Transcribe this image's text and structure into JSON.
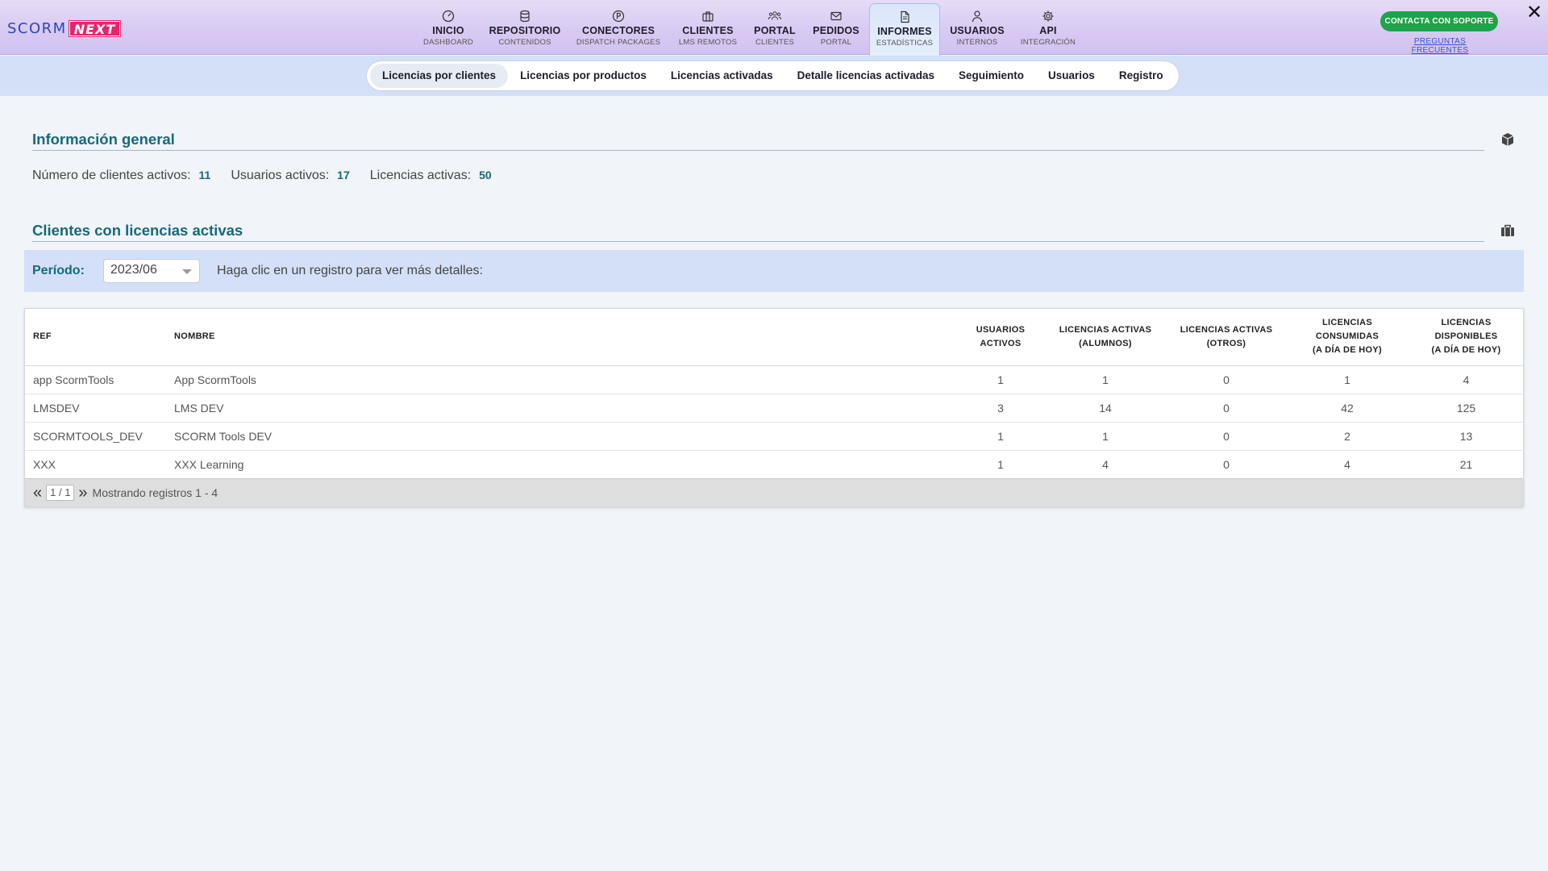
{
  "logo": {
    "part1": "SCORM",
    "part2": "NEXT"
  },
  "nav": [
    {
      "label": "INICIO",
      "sub": "DASHBOARD",
      "icon": "dashboard-gauge-icon"
    },
    {
      "label": "REPOSITORIO",
      "sub": "CONTENIDOS",
      "icon": "database-icon"
    },
    {
      "label": "CONECTORES",
      "sub": "DISPATCH PACKAGES",
      "icon": "connector-circle-icon"
    },
    {
      "label": "CLIENTES",
      "sub": "LMS REMOTOS",
      "icon": "briefcase-icon"
    },
    {
      "label": "PORTAL",
      "sub": "CLIENTES",
      "icon": "users-group-icon"
    },
    {
      "label": "PEDIDOS",
      "sub": "PORTAL",
      "icon": "envelope-icon"
    },
    {
      "label": "INFORMES",
      "sub": "ESTADÍSTICAS",
      "icon": "document-icon",
      "active": true
    },
    {
      "label": "USUARIOS",
      "sub": "INTERNOS",
      "icon": "user-icon"
    },
    {
      "label": "API",
      "sub": "INTEGRACIÓN",
      "icon": "gear-icon"
    }
  ],
  "support_button": "CONTACTA CON SOPORTE",
  "faq_link": "PREGUNTAS FRECUENTES",
  "close_symbol": "✕",
  "subnav": [
    {
      "label": "Licencias por clientes",
      "active": true
    },
    {
      "label": "Licencias por productos"
    },
    {
      "label": "Licencias activadas"
    },
    {
      "label": "Detalle licencias activadas"
    },
    {
      "label": "Seguimiento"
    },
    {
      "label": "Usuarios"
    },
    {
      "label": "Registro"
    }
  ],
  "general": {
    "title": "Información general",
    "icon": "cube-icon",
    "clients_label": "Número de clientes activos:",
    "clients_value": "11",
    "users_label": "Usuarios activos:",
    "users_value": "17",
    "licenses_label": "Licencias activas:",
    "licenses_value": "50"
  },
  "clients_section": {
    "title": "Clientes con licencias activas",
    "icon": "briefcase-icon",
    "period_label": "Período:",
    "period_value": "2023/06",
    "hint": "Haga clic en un registro para ver más detalles:"
  },
  "table": {
    "headers": {
      "ref": "REF",
      "nombre": "NOMBRE",
      "usuarios_1": "USUARIOS",
      "usuarios_2": "ACTIVOS",
      "lic_alumnos_1": "LICENCIAS ACTIVAS",
      "lic_alumnos_2": "(ALUMNOS)",
      "lic_otros_1": "LICENCIAS ACTIVAS",
      "lic_otros_2": "(OTROS)",
      "consumidas_1": "LICENCIAS",
      "consumidas_2": "CONSUMIDAS",
      "consumidas_3": "(A DÍA DE HOY)",
      "disponibles_1": "LICENCIAS",
      "disponibles_2": "DISPONIBLES",
      "disponibles_3": "(A DÍA DE HOY)"
    },
    "rows": [
      {
        "ref": "app ScormTools",
        "nombre": "App ScormTools",
        "usuarios": "1",
        "alumnos": "1",
        "otros": "0",
        "consumidas": "1",
        "disponibles": "4"
      },
      {
        "ref": "LMSDEV",
        "nombre": "LMS DEV",
        "usuarios": "3",
        "alumnos": "14",
        "otros": "0",
        "consumidas": "42",
        "disponibles": "125"
      },
      {
        "ref": "SCORMTOOLS_DEV",
        "nombre": "SCORM Tools DEV",
        "usuarios": "1",
        "alumnos": "1",
        "otros": "0",
        "consumidas": "2",
        "disponibles": "13"
      },
      {
        "ref": "XXX",
        "nombre": "XXX Learning",
        "usuarios": "1",
        "alumnos": "4",
        "otros": "0",
        "consumidas": "4",
        "disponibles": "21"
      }
    ],
    "pager": {
      "first": "«",
      "last": "»",
      "page": "1 / 1",
      "info": "Mostrando registros 1 - 4"
    }
  },
  "colors": {
    "accent_teal": "#17697b",
    "support_green": "#1ea34a",
    "brand_pink": "#e8246e",
    "brand_blue": "#2f46b9"
  }
}
